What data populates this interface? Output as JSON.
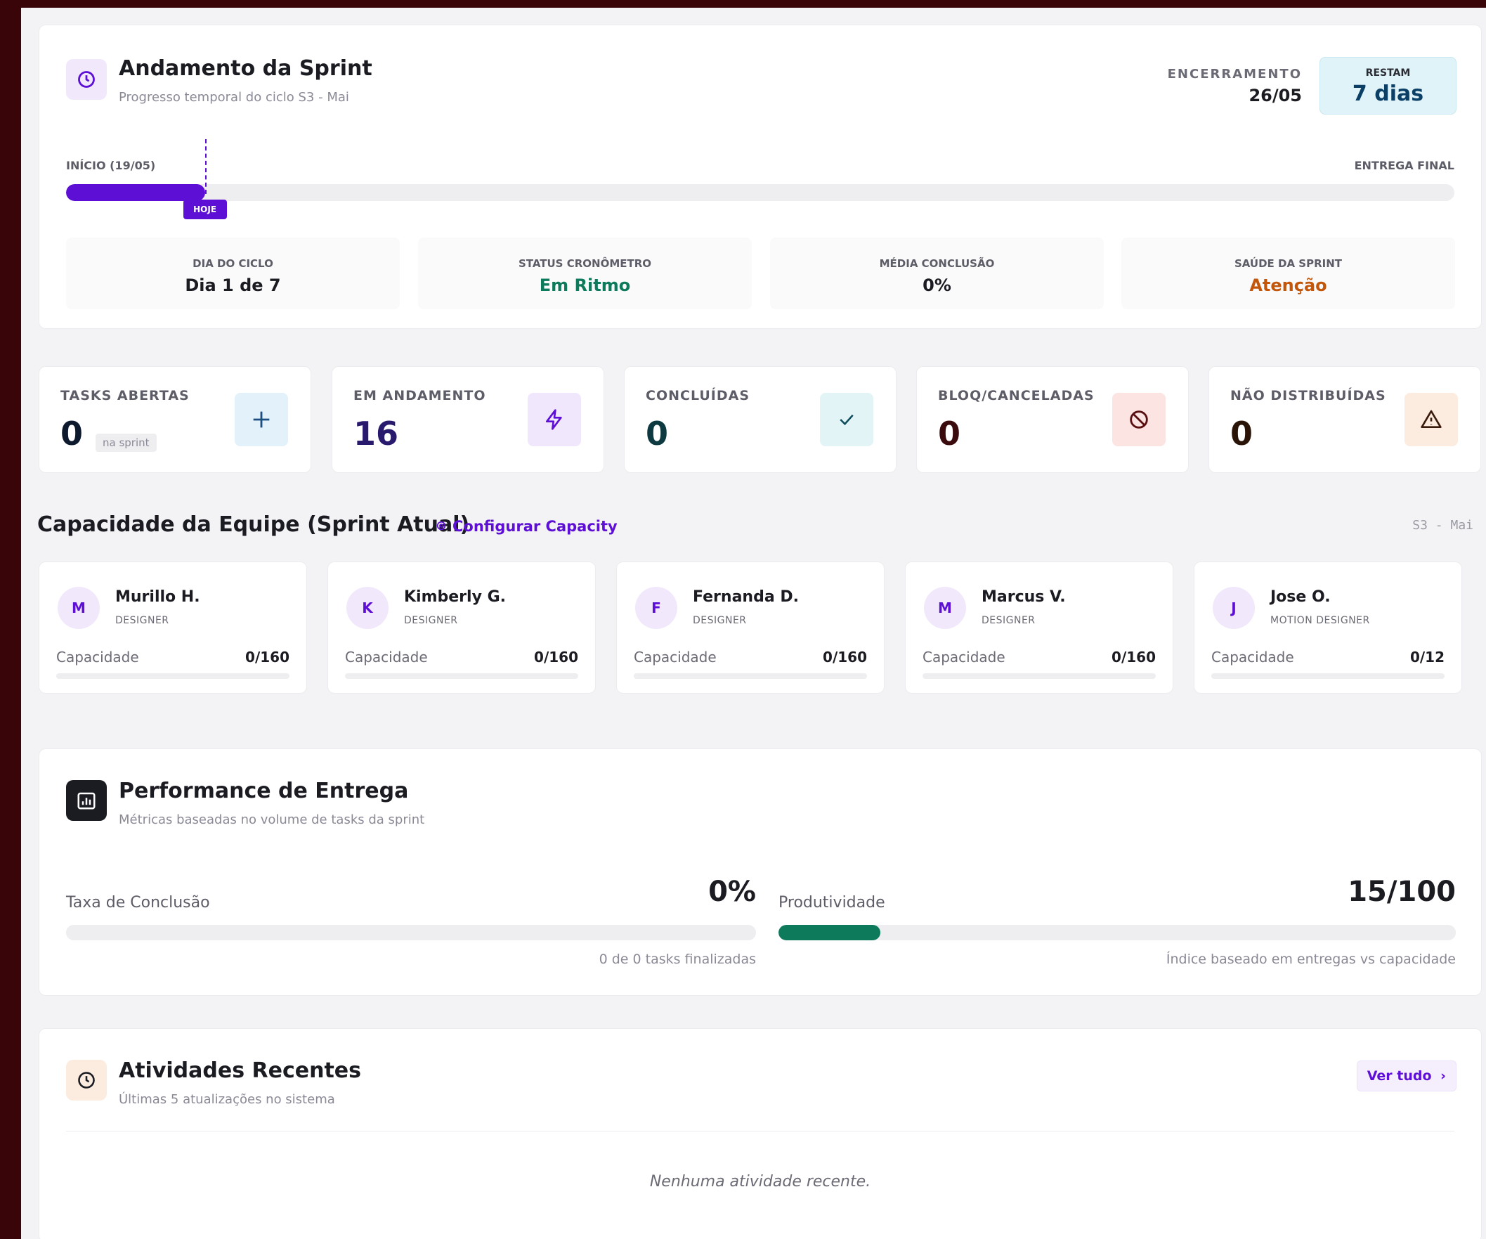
{
  "sprint": {
    "title": "Andamento da Sprint",
    "subtitle": "Progresso temporal do ciclo S3 - Mai",
    "end_label": "ENCERRAMENTO",
    "end_date": "26/05",
    "remaining_label": "RESTAM",
    "remaining_value": "7 dias",
    "start_label": "INÍCIO (19/05)",
    "final_label": "ENTREGA FINAL",
    "today_label": "HOJE",
    "progress_fraction": 0.1,
    "stats": [
      {
        "label": "DIA DO CICLO",
        "value": "Dia 1 de 7",
        "color": "#1b1b22"
      },
      {
        "label": "STATUS CRONÔMETRO",
        "value": "Em Ritmo",
        "color": "#0e7a5c"
      },
      {
        "label": "MÉDIA CONCLUSÃO",
        "value": "0%",
        "color": "#1b1b22"
      },
      {
        "label": "SAÚDE DA SPRINT",
        "value": "Atenção",
        "color": "#c2570c"
      }
    ]
  },
  "kpis": [
    {
      "label": "TASKS ABERTAS",
      "value": "0",
      "pill": "na sprint",
      "icon": "plus-icon",
      "bg": "#e3f1fb",
      "fg": "#1c4f80"
    },
    {
      "label": "EM ANDAMENTO",
      "value": "16",
      "icon": "lightning-icon",
      "bg": "#f0e7fd",
      "fg": "#5d0fd6"
    },
    {
      "label": "CONCLUÍDAS",
      "value": "0",
      "icon": "check-icon",
      "bg": "#e2f4f6",
      "fg": "#0d4d5c"
    },
    {
      "label": "BLOQ/CANCELADAS",
      "value": "0",
      "icon": "ban-icon",
      "bg": "#fbe4e1",
      "fg": "#5a0f10"
    },
    {
      "label": "NÃO DISTRIBUÍDAS",
      "value": "0",
      "icon": "warning-icon",
      "bg": "#fcece0",
      "fg": "#3a1a0a"
    }
  ],
  "capacity": {
    "title": "Capacidade da Equipe (Sprint Atual)",
    "config_link": "Configurar Capacity",
    "cycle_tag": "S3 - Mai",
    "cap_label": "Capacidade",
    "members": [
      {
        "initial": "M",
        "name": "Murillo H.",
        "role": "DESIGNER",
        "capacity": "0/160"
      },
      {
        "initial": "K",
        "name": "Kimberly G.",
        "role": "DESIGNER",
        "capacity": "0/160"
      },
      {
        "initial": "F",
        "name": "Fernanda D.",
        "role": "DESIGNER",
        "capacity": "0/160"
      },
      {
        "initial": "M",
        "name": "Marcus V.",
        "role": "DESIGNER",
        "capacity": "0/160"
      },
      {
        "initial": "J",
        "name": "Jose O.",
        "role": "MOTION DESIGNER",
        "capacity": "0/12"
      }
    ]
  },
  "performance": {
    "title": "Performance de Entrega",
    "subtitle": "Métricas baseadas no volume de tasks da sprint",
    "completion_label": "Taxa de Conclusão",
    "completion_value": "0%",
    "completion_fraction": 0,
    "completion_foot": "0 de 0 tasks finalizadas",
    "productivity_label": "Produtividade",
    "productivity_value": "15/100",
    "productivity_fraction": 0.15,
    "productivity_foot": "Índice baseado em entregas vs capacidade"
  },
  "activities": {
    "title": "Atividades Recentes",
    "subtitle": "Últimas 5 atualizações no sistema",
    "view_all": "Ver tudo",
    "view_all_chevron": "›",
    "empty": "Nenhuma atividade recente."
  }
}
